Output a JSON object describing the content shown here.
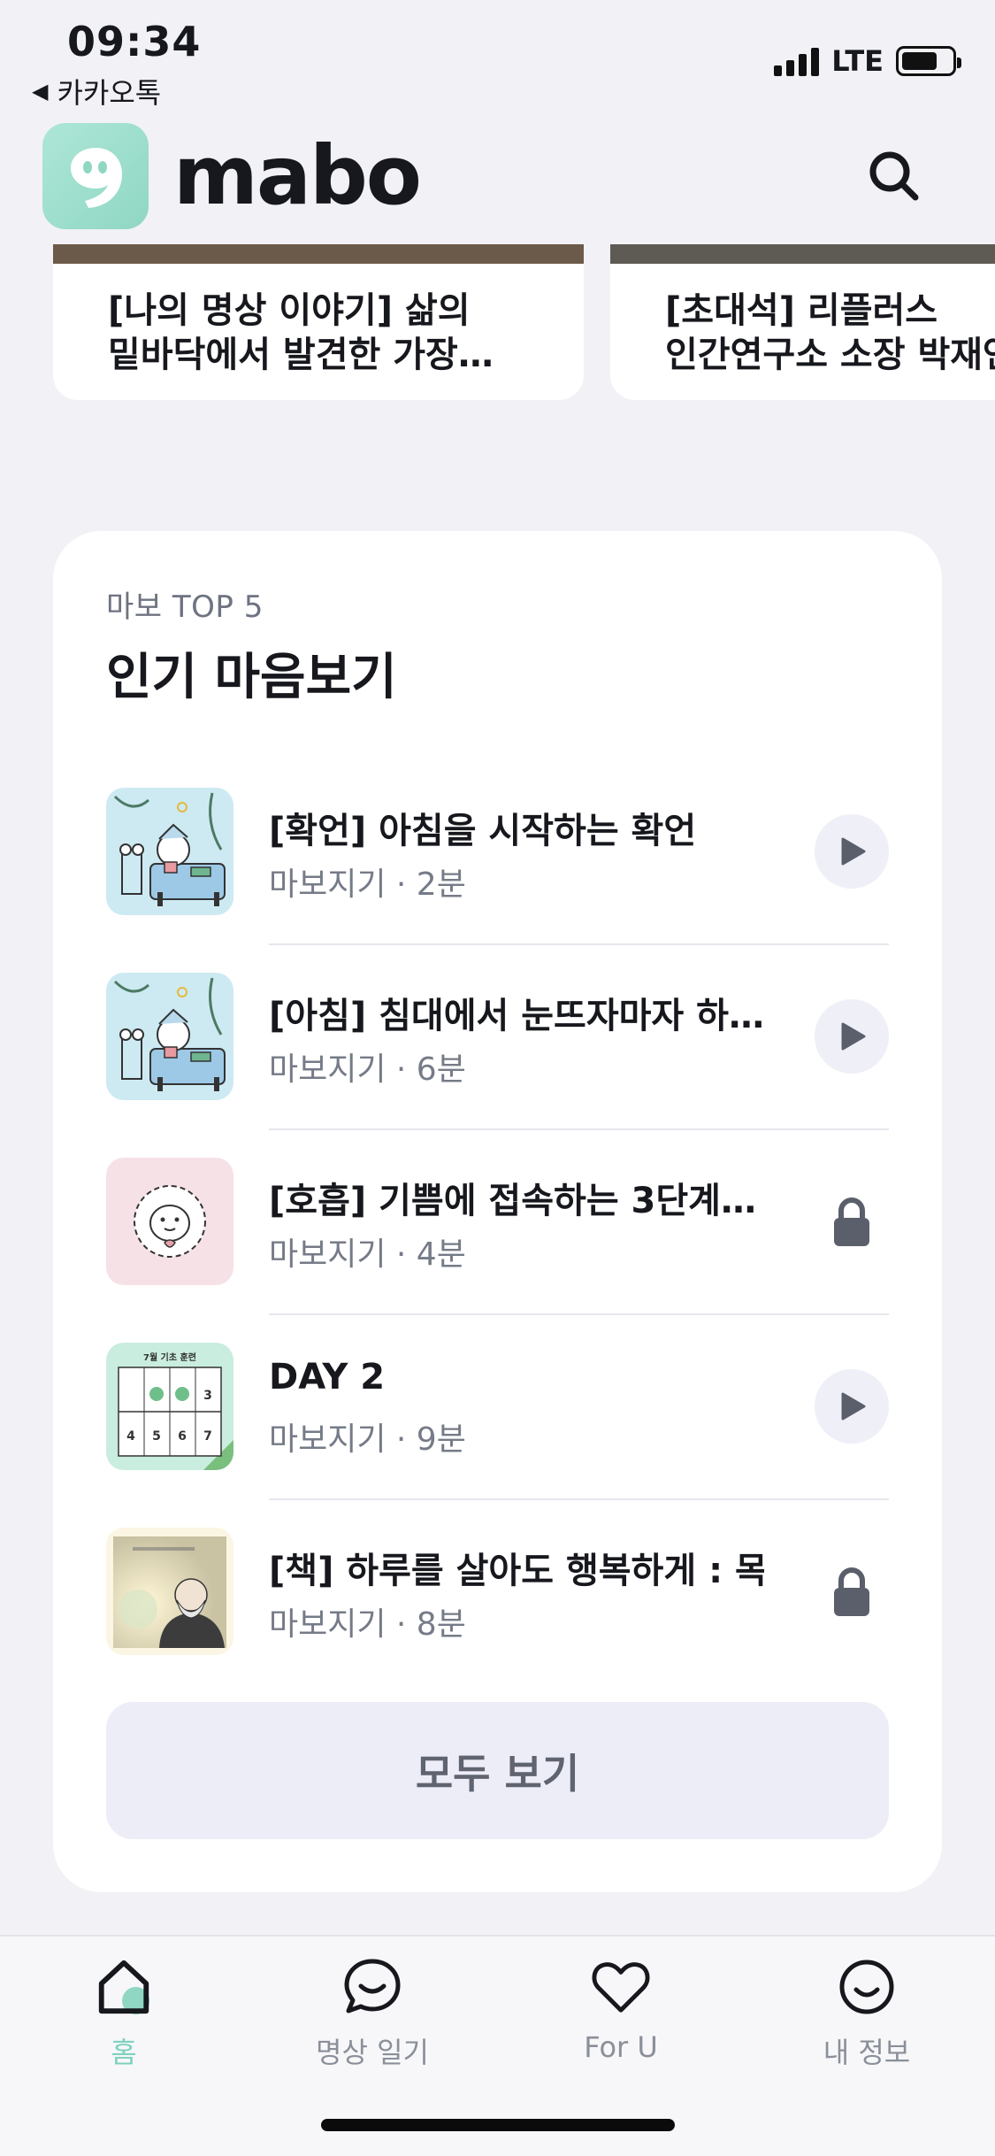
{
  "status_bar": {
    "time": "09:34",
    "back_app": "카카오톡",
    "network": "LTE"
  },
  "header": {
    "logo_text": "mabo",
    "brand_color": "#8fd7c3"
  },
  "carousel": [
    {
      "title_line1": "[나의 명상 이야기]  삶의",
      "title_line2": "밑바닥에서 발견한 가장…"
    },
    {
      "title_line1": "[초대석] 리플러스",
      "title_line2": "인간연구소 소장 박재연"
    }
  ],
  "top5": {
    "kicker": "마보 TOP 5",
    "title": "인기 마음보기",
    "items": [
      {
        "title": "[확언] 아침을 시작하는 확언",
        "meta": "마보지기 · 2분",
        "action": "play-icon",
        "thumb": "cat-in-bed"
      },
      {
        "title": "[아침] 침대에서 눈뜨자마자 하…",
        "meta": "마보지기 · 6분",
        "action": "play-icon",
        "thumb": "cat-in-bed"
      },
      {
        "title": "[호흡] 기쁨에 접속하는 3단계…",
        "meta": "마보지기 · 4분",
        "action": "lock-icon",
        "thumb": "sheep"
      },
      {
        "title": "DAY 2",
        "meta": "마보지기 · 9분",
        "action": "play-icon",
        "thumb": "calendar"
      },
      {
        "title": "[책] 하루를 살아도 행복하게 : 목…",
        "meta": "마보지기 · 8분",
        "action": "lock-icon",
        "thumb": "book-cover"
      }
    ],
    "thumb_calendar": {
      "header": "7월 기초 훈련",
      "numbers": [
        "3",
        "4",
        "5",
        "6",
        "7"
      ]
    },
    "view_all_label": "모두 보기"
  },
  "tabs": [
    {
      "label": "홈",
      "icon": "home-icon",
      "active": true
    },
    {
      "label": "명상 일기",
      "icon": "chat-bubble-icon",
      "active": false
    },
    {
      "label": "For U",
      "icon": "heart-icon",
      "active": false
    },
    {
      "label": "내 정보",
      "icon": "smile-icon",
      "active": false
    }
  ]
}
